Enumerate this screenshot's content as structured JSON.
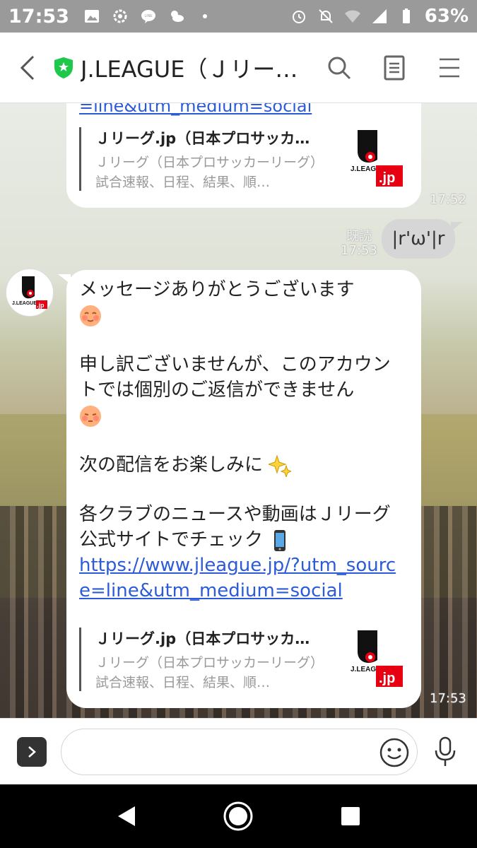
{
  "status_bar": {
    "time": "17:53",
    "battery": "63%",
    "icons": [
      "image-icon",
      "settings-gear-icon",
      "line-icon",
      "weather-icon",
      "dot-icon",
      "alarm-icon",
      "bell-off-icon",
      "wifi-icon",
      "signal-icon",
      "battery-icon"
    ]
  },
  "header": {
    "title": "J.LEAGUE（Ｊリー…",
    "back_icon": "chevron-left-icon",
    "verified_icon": "shield-star-icon",
    "search_icon": "search-icon",
    "notes_icon": "notes-icon",
    "menu_icon": "menu-icon"
  },
  "chat": {
    "earlier_message": {
      "link_tail": "=line&utm_medium=social",
      "preview": {
        "title": "Ｊリーグ.jp（日本プロサッカ…",
        "description": "Ｊリーグ（日本プロサッカーリーグ）試合速報、日程、結果、順…"
      },
      "time": "17:52"
    },
    "sent_message": {
      "text": "|r'ω'|r",
      "read_status": "既読",
      "time": "17:53"
    },
    "reply_message": {
      "line1": "メッセージありがとうございます",
      "line2": "申し訳ございませんが、このアカウントでは個別のご返信ができません",
      "line3": "次の配信をお楽しみに",
      "line4": "各クラブのニュースや動画はＪリーグ公式サイトでチェック",
      "link": "https://www.jleague.jp/?utm_source=line&utm_medium=social",
      "preview": {
        "title": "Ｊリーグ.jp（日本プロサッカ…",
        "description": "Ｊリーグ（日本プロサッカーリーグ）試合速報、日程、結果、順…"
      },
      "time": "17:53"
    },
    "logo_text": "J.LEAGUE",
    "logo_jp": ".jp"
  },
  "input_bar": {
    "placeholder": "",
    "expand_icon": "chevron-right-icon",
    "emoji_icon": "smiley-icon",
    "mic_icon": "microphone-icon"
  },
  "nav_bar": {
    "back_icon": "triangle-back-icon",
    "home_icon": "circle-home-icon",
    "recents_icon": "square-recents-icon"
  },
  "colors": {
    "link": "#2c5bd8",
    "verified_green": "#1ec84a",
    "jleague_red": "#e60012"
  }
}
